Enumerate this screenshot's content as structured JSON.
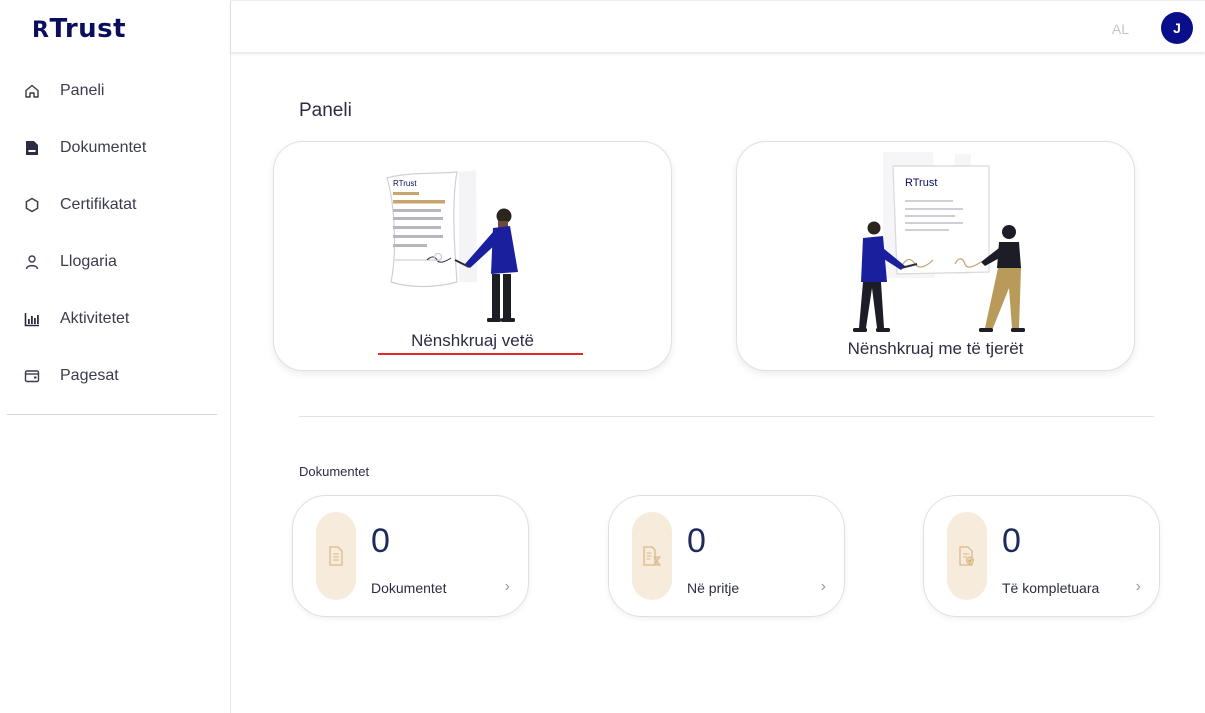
{
  "brand": {
    "logo_prefix": "R",
    "logo_text": "Trust"
  },
  "sidebar": {
    "items": [
      {
        "label": "Paneli",
        "icon": "home-icon"
      },
      {
        "label": "Dokumentet",
        "icon": "document-icon"
      },
      {
        "label": "Certifikatat",
        "icon": "certificate-icon"
      },
      {
        "label": "Llogaria",
        "icon": "user-icon"
      },
      {
        "label": "Aktivitetet",
        "icon": "chart-bar-icon"
      },
      {
        "label": "Pagesat",
        "icon": "wallet-icon"
      }
    ]
  },
  "topbar": {
    "language": "AL",
    "avatar_initial": "J"
  },
  "main": {
    "title": "Paneli",
    "actions": [
      {
        "label": "Nënshkruaj vetë",
        "illustration_brand": "RTrust"
      },
      {
        "label": "Nënshkruaj me të tjerët",
        "illustration_brand": "RTrust"
      }
    ],
    "documents_section": {
      "title": "Dokumentet",
      "stats": [
        {
          "count": "0",
          "label": "Dokumentet"
        },
        {
          "count": "0",
          "label": "Në pritje"
        },
        {
          "count": "0",
          "label": "Të kompletuara"
        }
      ]
    }
  },
  "colors": {
    "brand": "#0b0e5c",
    "accent_pill": "#f7ecdc",
    "underline": "#e12b2b"
  }
}
